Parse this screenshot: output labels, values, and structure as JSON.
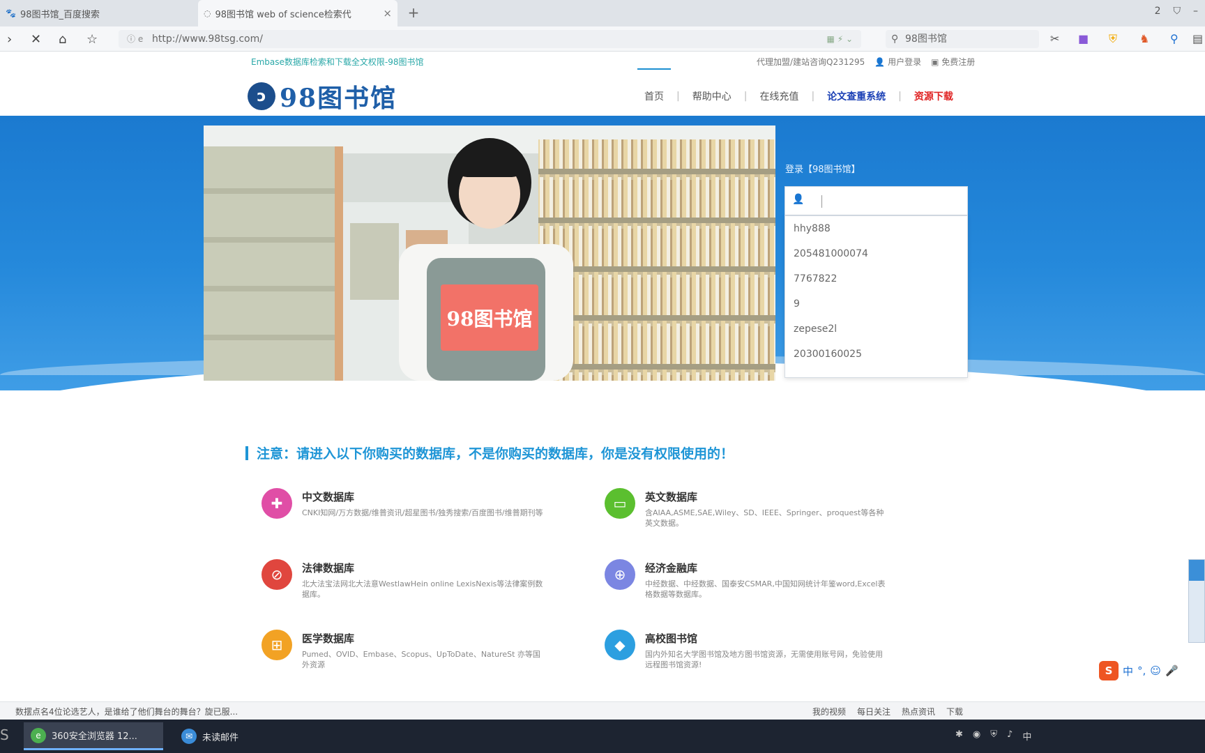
{
  "browser": {
    "tabs": [
      {
        "label": "98图书馆_百度搜索",
        "active": false
      },
      {
        "label": "98图书馆 web of science检索代",
        "active": true
      }
    ],
    "tab_count": "2",
    "url": "http://www.98tsg.com/",
    "search_text": "98图书馆"
  },
  "site": {
    "top_notice": "Embase数据库检索和下载全文权限-98图书馆",
    "top_right": {
      "contact": "代理加盟/建站咨询Q231295",
      "login": "用户登录",
      "register": "免费注册"
    },
    "logo_text": "98图书馆",
    "nav": [
      {
        "label": "首页",
        "style": "active"
      },
      {
        "label": "帮助中心",
        "style": "normal"
      },
      {
        "label": "在线充值",
        "style": "normal"
      },
      {
        "label": "论文查重系统",
        "style": "blue"
      },
      {
        "label": "资源下载",
        "style": "red"
      }
    ]
  },
  "hero": {
    "banner_sign": "98图书馆",
    "login_title": "登录【98图书馆】",
    "username_value": "",
    "suggestions": [
      "hhy888",
      "205481000074",
      "7767822",
      "9",
      "zepese2l",
      "20300160025"
    ]
  },
  "content": {
    "notice": "注意：请进入以下你购买的数据库，不是你购买的数据库，你是没有权限使用的！",
    "databases": [
      {
        "title": "中文数据库",
        "desc": "CNKI知网/万方数据/维普资讯/超星图书/独秀搜索/百度图书/维普期刊等",
        "color": "#e04ea6",
        "icon": "plus-cross-icon"
      },
      {
        "title": "英文数据库",
        "desc": "含AIAA,ASME,SAE,Wiley、SD、IEEE、Springer、proquest等各种英文数据。",
        "color": "#5bbf2f",
        "icon": "screen-icon"
      },
      {
        "title": "法律数据库",
        "desc": "北大法宝法网北大法意WestlawHein online LexisNexis等法律案例数据库。",
        "color": "#e0463e",
        "icon": "forbidden-icon"
      },
      {
        "title": "经济金融库",
        "desc": "中经数据、中经数据、国泰安CSMAR,中国知网统计年鉴word,Excel表格数据等数据库。",
        "color": "#7b86e2",
        "icon": "globe-icon"
      },
      {
        "title": "医学数据库",
        "desc": "Pumed、OVID、Embase、Scopus、UpToDate、NatureSt 亦等国外资源",
        "color": "#f2a224",
        "icon": "grid-icon"
      },
      {
        "title": "高校图书馆",
        "desc": "国内外知名大学图书馆及地方图书馆资源，无需使用账号网，免验使用远程图书馆资源!",
        "color": "#2c9fe0",
        "icon": "diamond-icon"
      }
    ]
  },
  "statusbar": {
    "news": "数摆点名4位论选艺人，是谁给了他们舞台的舞台？旋已服...",
    "tools": [
      "我的视频",
      "每日关注",
      "热点资讯",
      "下载"
    ]
  },
  "taskbar": {
    "items": [
      "360安全浏览器 12...",
      "未读邮件"
    ],
    "ime": "中"
  }
}
